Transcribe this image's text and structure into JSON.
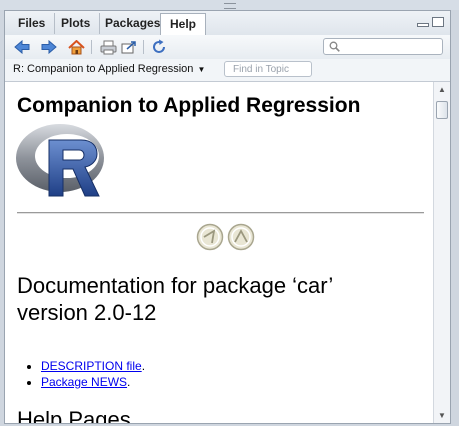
{
  "tabs": [
    {
      "label": "Files"
    },
    {
      "label": "Plots"
    },
    {
      "label": "Packages"
    },
    {
      "label": "Help"
    }
  ],
  "active_tab": "Help",
  "toolbar": {
    "icons": [
      "back-arrow-icon",
      "forward-arrow-icon",
      "home-icon",
      "print-icon",
      "open-in-new-window-icon",
      "refresh-icon"
    ]
  },
  "search": {
    "placeholder": ""
  },
  "topic_bar": {
    "topic": "R: Companion to Applied Regression",
    "find_placeholder": "Find in Topic"
  },
  "doc": {
    "title": "Companion to Applied Regression",
    "heading": "Documentation for package ‘car’ version 2.0-12",
    "links": [
      "DESCRIPTION file",
      "Package NEWS"
    ],
    "link_suffix": ".",
    "section": "Help Pages"
  },
  "colors": {
    "link": "#0000ee",
    "accent": "#3b6bb5"
  }
}
